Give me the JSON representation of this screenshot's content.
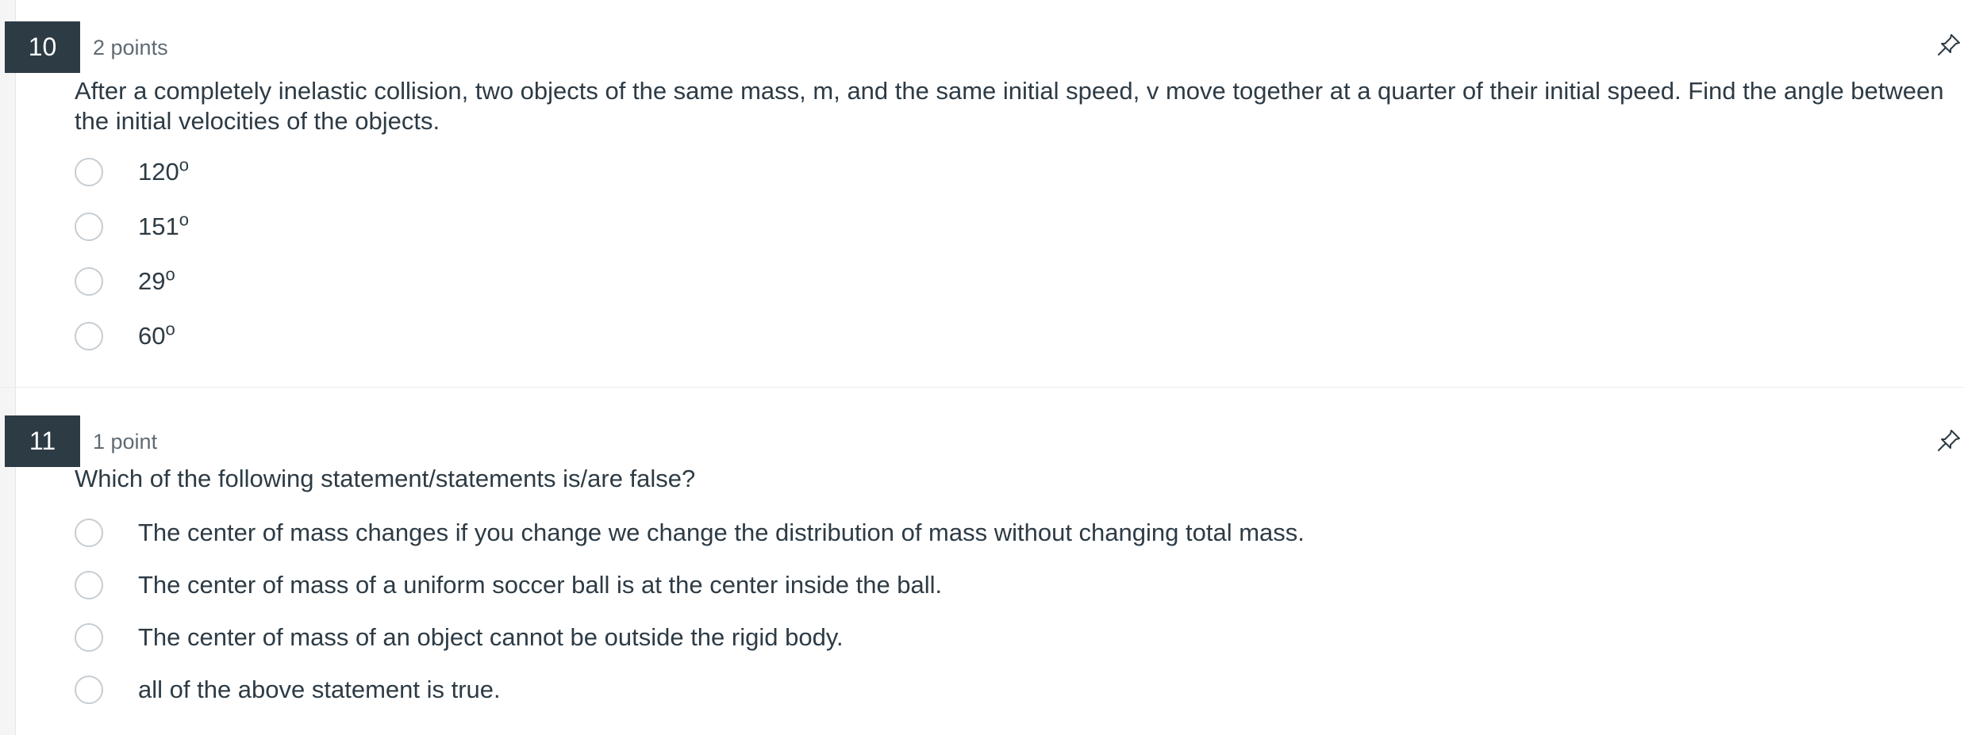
{
  "questions": [
    {
      "number": "10",
      "points": "2 points",
      "text": "After a completely inelastic collision, two objects of the same mass, m, and the same initial speed, v move together at a quarter of their initial speed. Find the angle between the initial velocities of the objects.",
      "answers": [
        {
          "value": "120",
          "unit": "o"
        },
        {
          "value": "151",
          "unit": "o"
        },
        {
          "value": "29",
          "unit": "o"
        },
        {
          "value": "60",
          "unit": "o"
        }
      ],
      "pin_icon": "pin-icon"
    },
    {
      "number": "11",
      "points": "1 point",
      "text": "Which of the following statement/statements is/are false?",
      "answers": [
        {
          "value": "The center of mass changes if you change we change the distribution of mass without changing total mass."
        },
        {
          "value": "The center of mass of  a uniform soccer ball is at the center inside the ball."
        },
        {
          "value": "The center of mass of an object cannot be outside the rigid body."
        },
        {
          "value": "all of the above statement is true."
        }
      ],
      "pin_icon": "pin-icon"
    }
  ],
  "colors": {
    "number_badge_bg": "#2d3b45",
    "text": "#2d3b45",
    "points_text": "#5f6b74",
    "radio_border": "#c7cdd1"
  }
}
